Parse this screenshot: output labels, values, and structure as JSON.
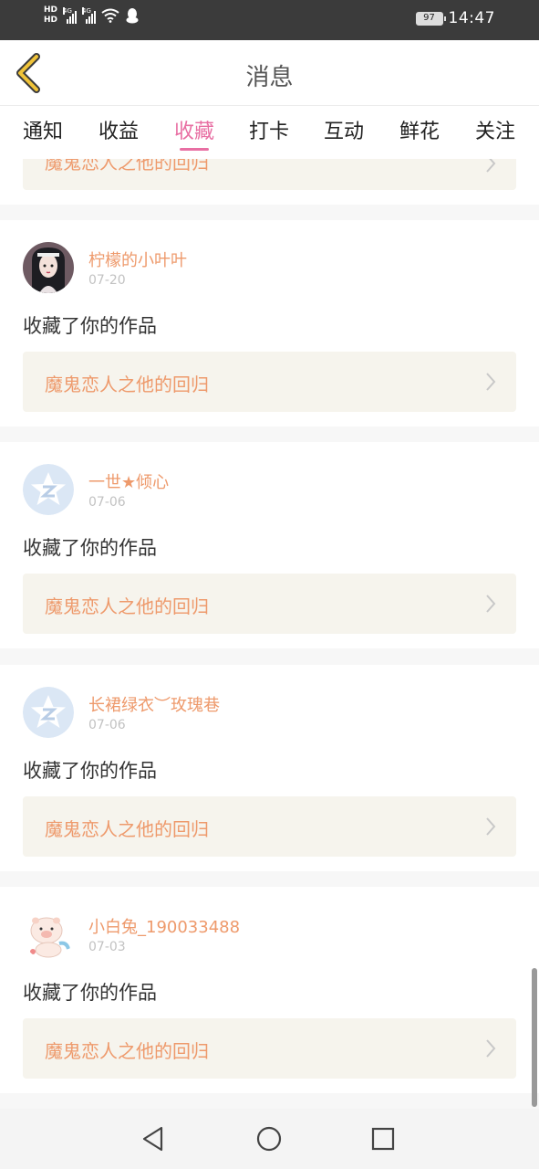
{
  "status_bar": {
    "hd1": "HD",
    "hd2": "HD",
    "sim1_tag": "4G",
    "sim2_tag": "4G",
    "battery": "97",
    "time": "14:47"
  },
  "header": {
    "title": "消息"
  },
  "tabs": [
    {
      "label": "通知",
      "active": false
    },
    {
      "label": "收益",
      "active": false
    },
    {
      "label": "收藏",
      "active": true
    },
    {
      "label": "打卡",
      "active": false
    },
    {
      "label": "互动",
      "active": false
    },
    {
      "label": "鲜花",
      "active": false
    },
    {
      "label": "关注",
      "active": false
    }
  ],
  "feed": {
    "partial_top": {
      "work_title": "魔鬼恋人之他的回归"
    },
    "items": [
      {
        "username": "柠檬的小叶叶",
        "date": "07-20",
        "action": "收藏了你的作品",
        "work_title": "魔鬼恋人之他的回归",
        "avatar": "illustrated-girl-avatar"
      },
      {
        "username": "一世★倾心",
        "date": "07-06",
        "action": "收藏了你的作品",
        "work_title": "魔鬼恋人之他的回归",
        "avatar": "default-star-avatar"
      },
      {
        "username": "长裙绿衣︶玫瑰巷",
        "date": "07-06",
        "action": "收藏了你的作品",
        "work_title": "魔鬼恋人之他的回归",
        "avatar": "default-star-avatar"
      },
      {
        "username": "小白兔_190033488",
        "date": "07-03",
        "action": "收藏了你的作品",
        "work_title": "魔鬼恋人之他的回归",
        "avatar": "cartoon-pig-avatar"
      }
    ]
  },
  "colors": {
    "accent_tab": "#e86fa3",
    "username": "#ee9a6c",
    "work_bg": "#f6f4ed",
    "back_arrow": "#f0c338"
  }
}
